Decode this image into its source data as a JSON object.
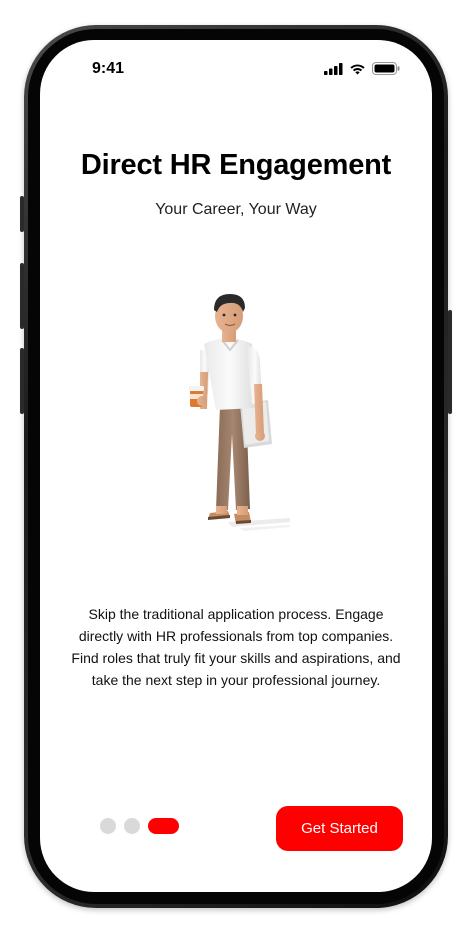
{
  "status_bar": {
    "time": "9:41",
    "icons": [
      "cellular-signal-icon",
      "wifi-icon",
      "battery-icon"
    ]
  },
  "onboarding": {
    "title": "Direct HR Engagement",
    "subtitle": "Your Career, Your Way",
    "illustration": "man-with-coffee-and-laptop-illustration",
    "description": "Skip the traditional application process. Engage directly with HR professionals from top companies. Find roles that truly fit your skills and aspirations, and take the next step in your professional journey.",
    "page_indicator": {
      "total": 3,
      "current": 3
    },
    "cta_label": "Get Started"
  },
  "colors": {
    "accent": "#ff0000",
    "dot_inactive": "#d9d9d9",
    "text": "#000000",
    "background": "#ffffff"
  }
}
